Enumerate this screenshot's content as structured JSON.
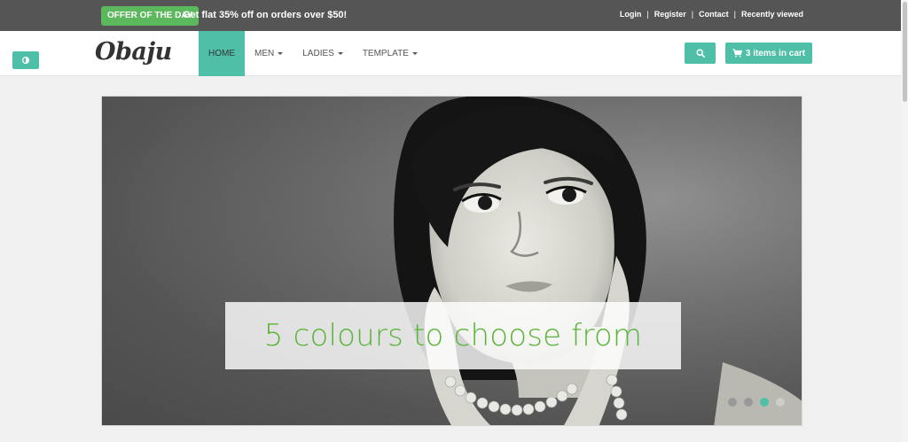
{
  "topbar": {
    "offer_badge": "OFFER OF THE DAY",
    "offer_text": "Get flat 35% off on orders over $50!",
    "links": [
      {
        "label": "Login"
      },
      {
        "label": "Register"
      },
      {
        "label": "Contact"
      },
      {
        "label": "Recently viewed"
      }
    ]
  },
  "navbar": {
    "logo": "Obaju",
    "items": [
      {
        "label": "HOME",
        "active": true
      },
      {
        "label": "MEN",
        "dropdown": true
      },
      {
        "label": "LADIES",
        "dropdown": true
      },
      {
        "label": "TEMPLATE",
        "dropdown": true
      }
    ],
    "cart_label": "3 items in cart"
  },
  "icons": {
    "style_toggle": "contrast-icon",
    "search": "search-icon",
    "cart": "shopping-cart-icon"
  },
  "hero": {
    "caption": "5 colours to choose from",
    "slide_count": 4,
    "active_slide": 3
  },
  "colors": {
    "accent": "#4fbfa8",
    "offer_badge": "#5cb85c",
    "caption_text": "#5ab43a",
    "topbar_bg": "#555555"
  }
}
